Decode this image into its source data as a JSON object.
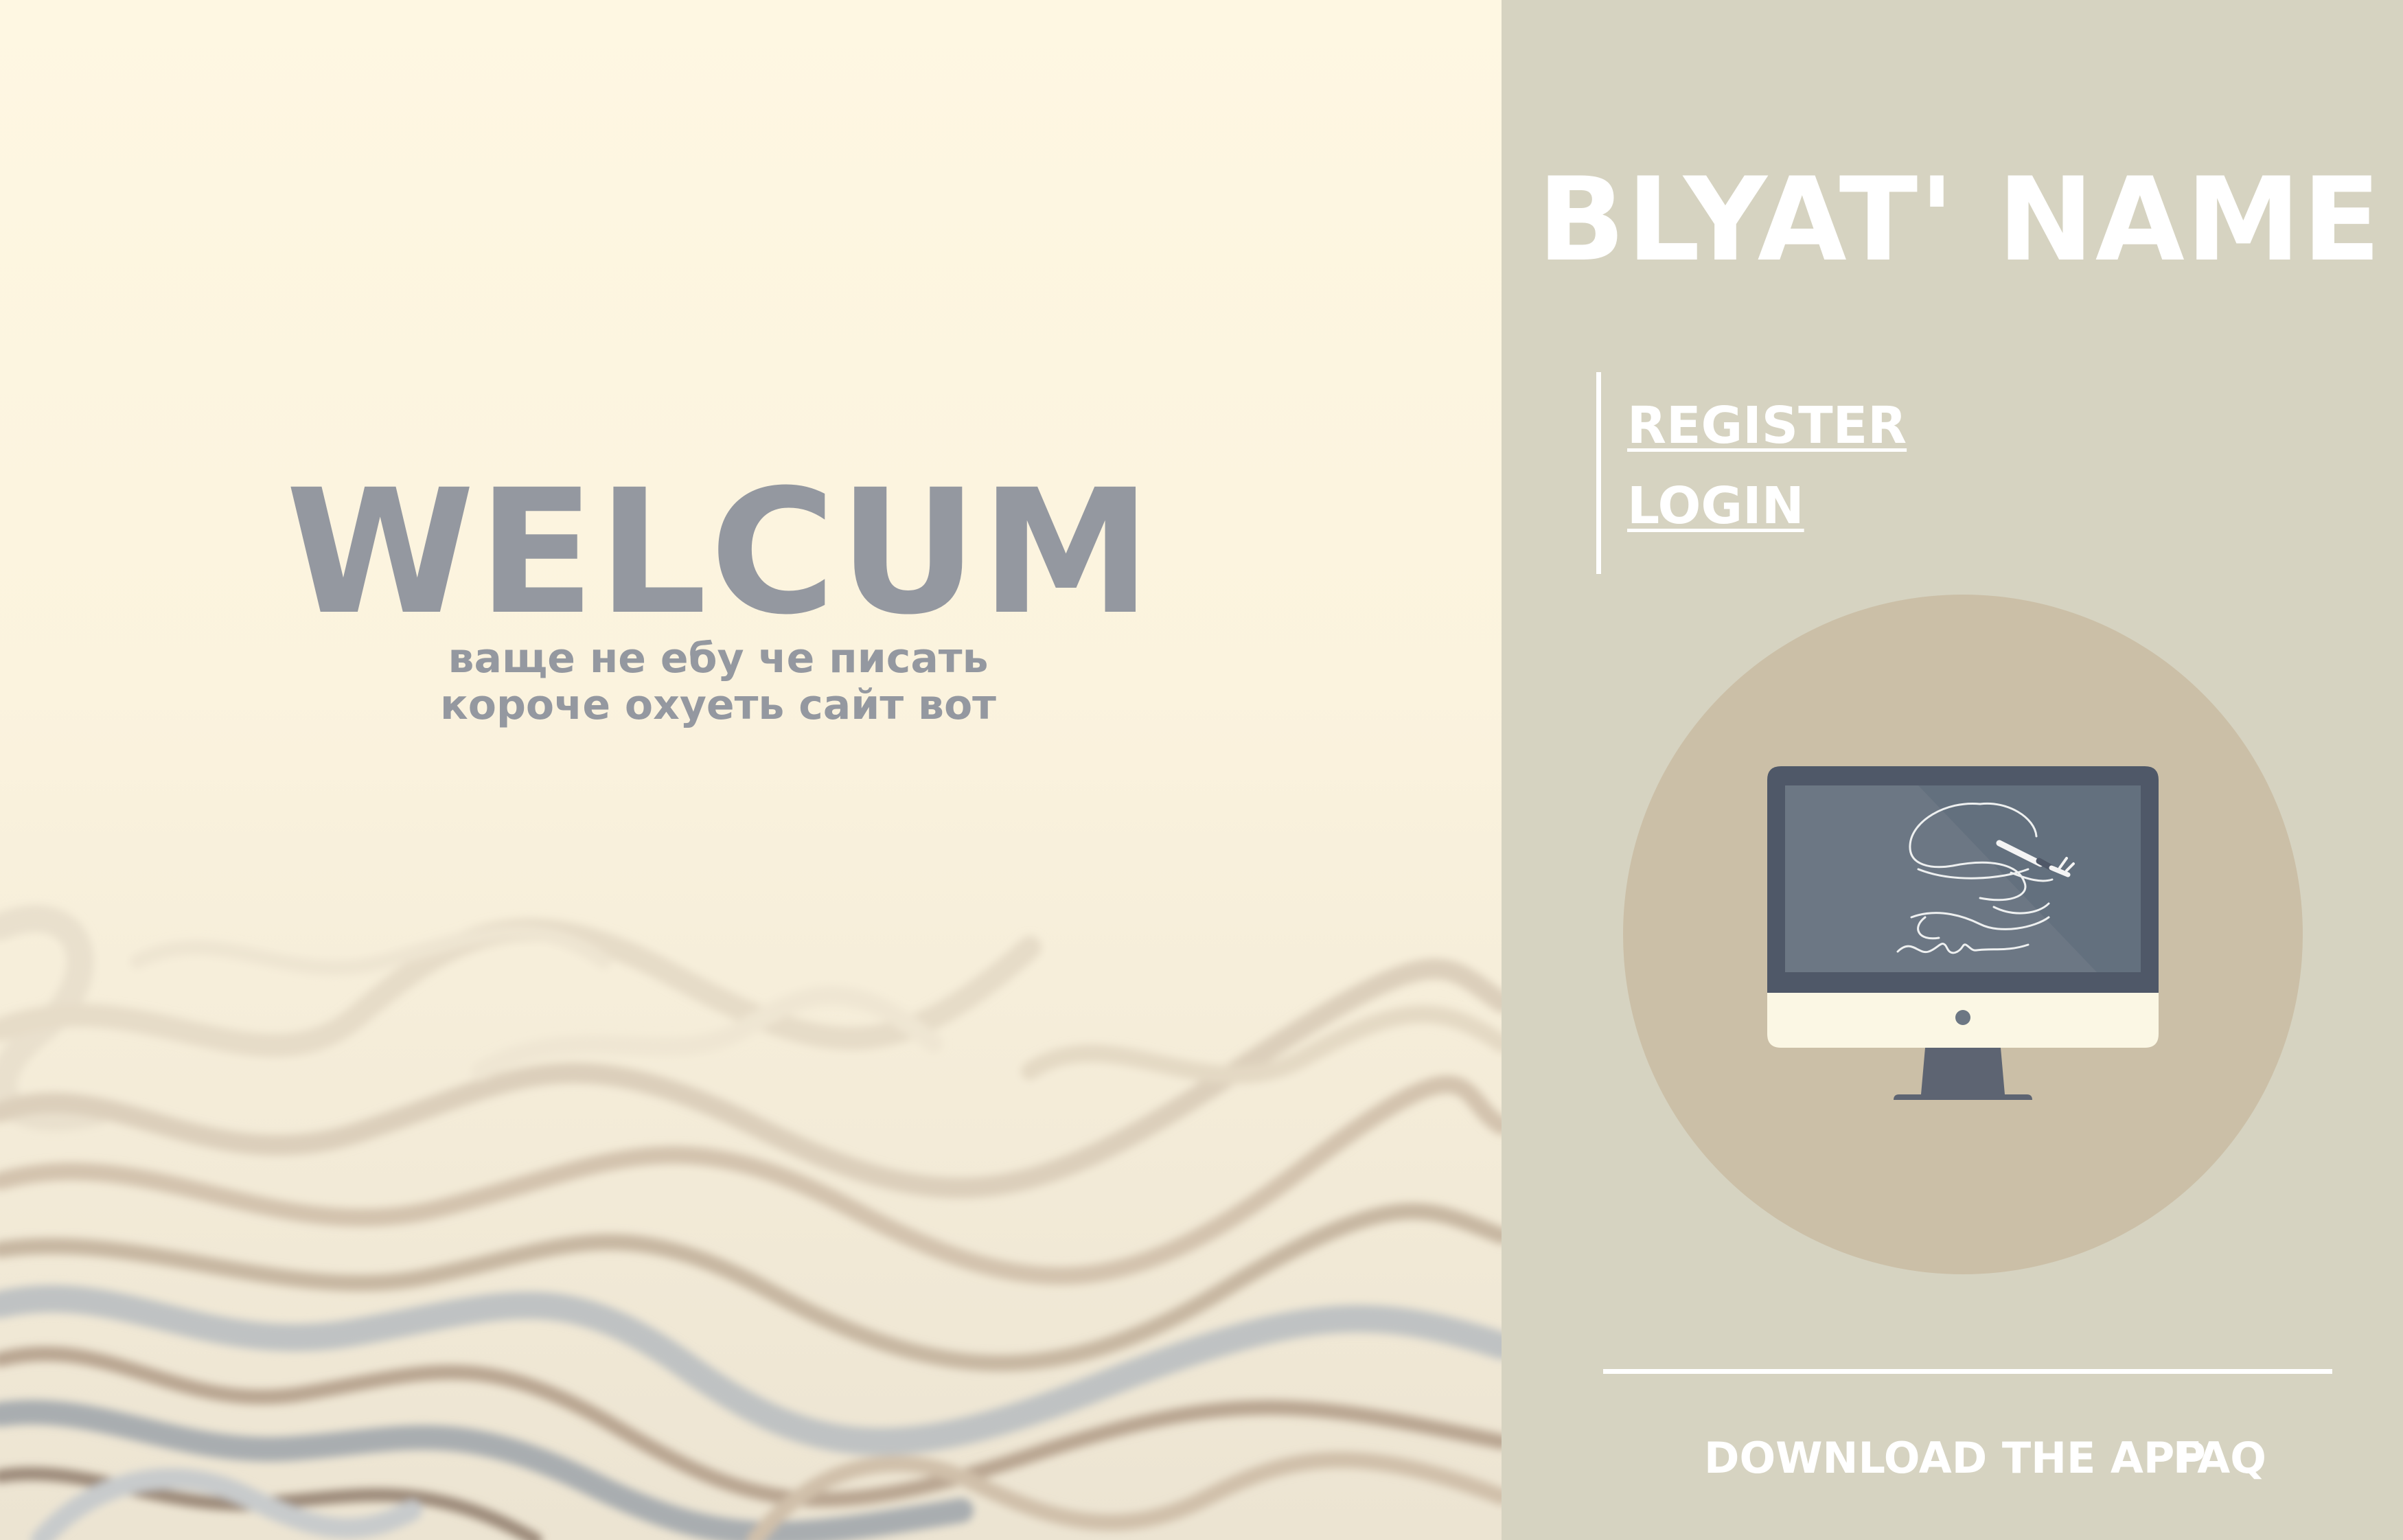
{
  "hero": {
    "title": "WELCUM",
    "subtitle_line1": "ваще не ебу че писать",
    "subtitle_line2": "короче охуеть сайт вот"
  },
  "sidebar": {
    "brand": "BLYAT' NAME",
    "nav": {
      "register_label": "REGISTER",
      "login_label": "LOGIN"
    },
    "emblem_icon": "monitor-with-signature-icon",
    "footer": {
      "download_label": "DOWNLOAD THE APP",
      "faq_label": "FAQ"
    }
  },
  "colors": {
    "hero_background": "#fdf6e3",
    "hero_text": "#9498a0",
    "sidebar_background": "#d6d3c1",
    "emblem_circle": "#cbbfa7",
    "monitor_frame": "#4f5868",
    "monitor_screen": "#6c7784",
    "monitor_chin": "#fbf7e4",
    "sidebar_text": "#ffffff"
  }
}
